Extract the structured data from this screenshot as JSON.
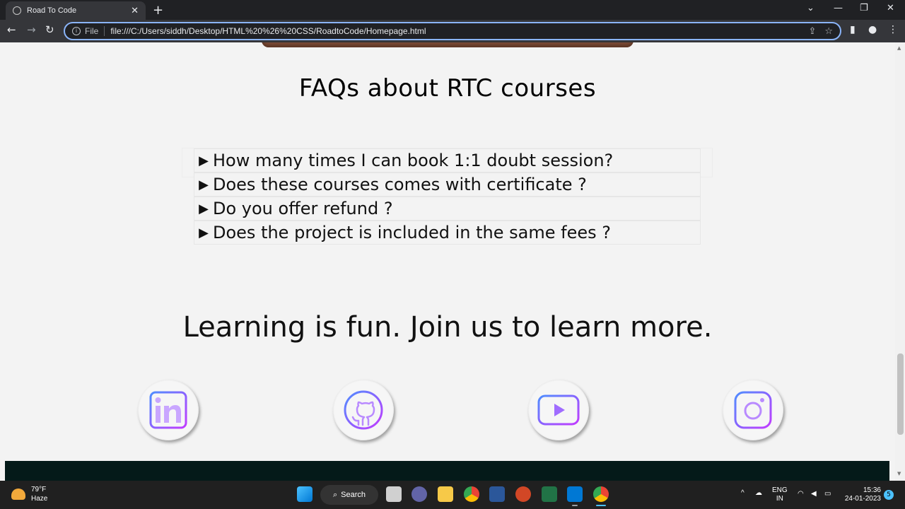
{
  "browser": {
    "tab_title": "Road To Code",
    "address_scheme": "File",
    "address_url": "file:///C:/Users/siddh/Desktop/HTML%20%26%20CSS/RoadtoCode/Homepage.html"
  },
  "page": {
    "faq_title": "FAQs about RTC courses",
    "faqs": [
      "How many times I can book 1:1 doubt session?",
      "Does these courses comes with certificate ?",
      "Do you offer refund ?",
      "Does the project is included in the same fees ?"
    ],
    "tagline": "Learning is fun. Join us to learn more.",
    "social_icons": [
      "linkedin-icon",
      "github-icon",
      "youtube-icon",
      "instagram-icon"
    ]
  },
  "taskbar": {
    "weather_temp": "79°F",
    "weather_desc": "Haze",
    "search_label": "Search",
    "lang_top": "ENG",
    "lang_bottom": "IN",
    "time": "15:36",
    "date": "24-01-2023",
    "notification_count": "5"
  },
  "colors": {
    "page_bg": "#f3f3f3",
    "icon_gradient_start": "#4f8dff",
    "icon_gradient_end": "#c13bff",
    "footer_dark": "#041a19"
  }
}
